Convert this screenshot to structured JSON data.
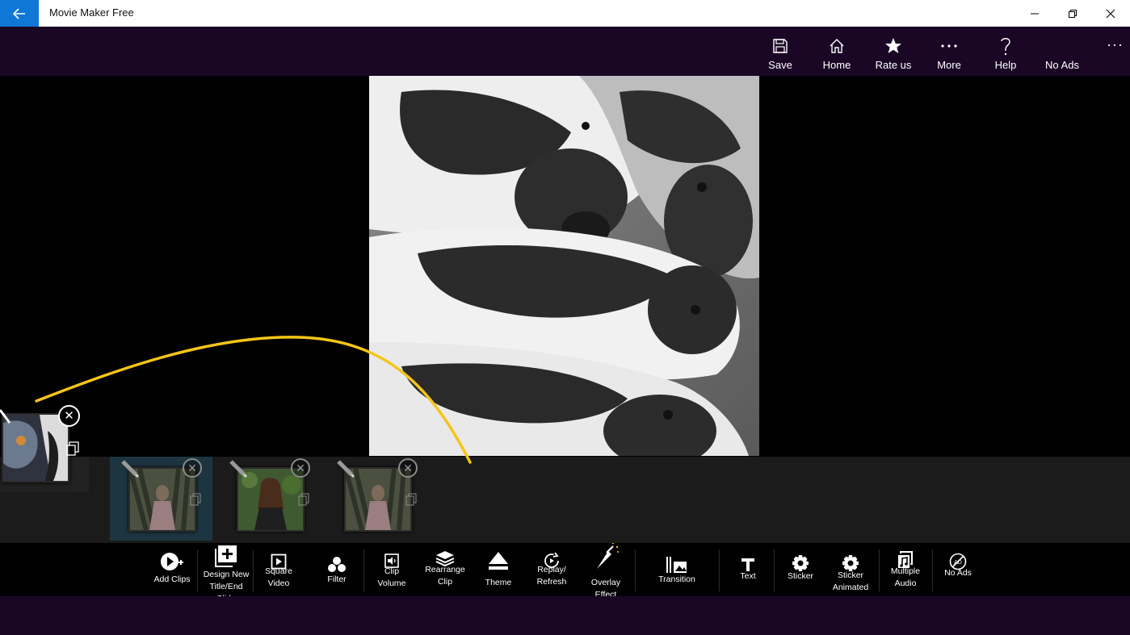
{
  "window": {
    "title": "Movie Maker Free"
  },
  "commands": [
    {
      "label": "Save",
      "icon": "save-icon"
    },
    {
      "label": "Home",
      "icon": "home-icon"
    },
    {
      "label": "Rate us",
      "icon": "star-icon"
    },
    {
      "label": "More",
      "icon": "more-icon"
    },
    {
      "label": "Help",
      "icon": "help-icon"
    },
    {
      "label": "No Ads",
      "icon": "none"
    }
  ],
  "tools": [
    {
      "label": "Add Clips",
      "icon": "add-clips-icon"
    },
    {
      "label": "Design New\nTitle/End\nSlide",
      "icon": "add-slide-icon"
    },
    {
      "label": "Square\nVideo",
      "icon": "square-video-icon"
    },
    {
      "label": "Filter",
      "icon": "filter-icon"
    },
    {
      "label": "Clip\nVolume",
      "icon": "volume-icon"
    },
    {
      "label": "Rearrange\nClip",
      "icon": "layers-icon"
    },
    {
      "label": "Theme",
      "icon": "eject-icon"
    },
    {
      "label": "Replay/\nRefresh",
      "icon": "refresh-icon"
    },
    {
      "label": "Overlay\nEffect",
      "icon": "overlay-icon"
    },
    {
      "label": "Transition",
      "icon": "transition-icon"
    },
    {
      "label": "Text",
      "icon": "text-icon"
    },
    {
      "label": "Sticker",
      "icon": "gear-icon"
    },
    {
      "label": "Sticker\nAnimated",
      "icon": "gear-icon"
    },
    {
      "label": "Multiple\nAudio",
      "icon": "music-icon"
    },
    {
      "label": "No Ads",
      "icon": "no-ads-icon"
    }
  ],
  "colors": {
    "accent": "#0f78d7",
    "bar": "#1a0726",
    "highlight": "#f5c518"
  }
}
